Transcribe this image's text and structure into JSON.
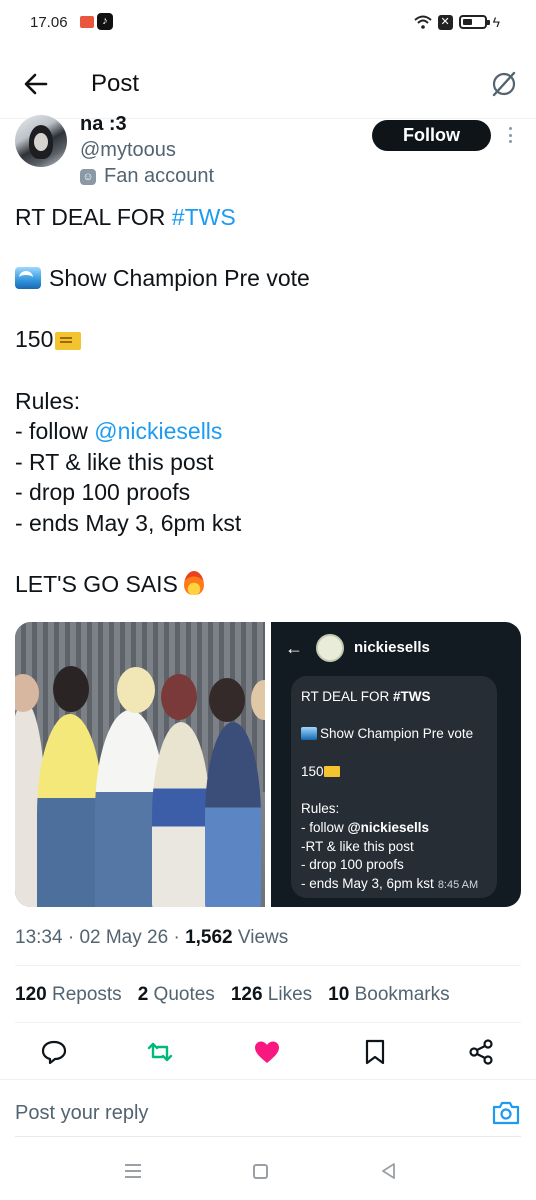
{
  "status_bar": {
    "time": "17.06",
    "battery_level": 0.45
  },
  "header": {
    "title": "Post",
    "back_icon": "arrow-left-icon",
    "grok_icon": "grok-icon"
  },
  "author": {
    "name": "na :3",
    "handle": "@mytoous",
    "label": "Fan account",
    "follow_label": "Follow"
  },
  "tweet": {
    "line1_prefix": "RT DEAL FOR ",
    "line1_tag": "#TWS",
    "line2": "Show Champion Pre vote",
    "line3": "150",
    "rules_title": "Rules:",
    "rule1_prefix": "- follow ",
    "rule1_mention": "@nickiesells",
    "rule2": "- RT & like this post",
    "rule3": "- drop 100 proofs",
    "rule4": "- ends May 3, 6pm kst",
    "closing": "LET'S GO SAIS"
  },
  "media_screenshot": {
    "account_name": "nickiesells",
    "line1_prefix": "RT DEAL FOR ",
    "line1_tag": "#TWS",
    "line2": "Show Champion Pre vote",
    "line3": "150",
    "rules_title": "Rules:",
    "rule1_prefix": "- follow ",
    "rule1_mention": "@nickiesells",
    "rule2": "-RT & like this post",
    "rule3": "- drop 100 proofs",
    "rule4": "- ends May 3, 6pm kst",
    "timestamp": "8:45 AM"
  },
  "meta": {
    "time": "13:34",
    "date": "02 May 26",
    "views_count": "1,562",
    "views_label": "Views"
  },
  "stats": {
    "reposts_count": "120",
    "reposts_label": "Reposts",
    "quotes_count": "2",
    "quotes_label": "Quotes",
    "likes_count": "126",
    "likes_label": "Likes",
    "bookmarks_count": "10",
    "bookmarks_label": "Bookmarks"
  },
  "reply": {
    "placeholder": "Post your reply"
  },
  "colors": {
    "link": "#1d9bf0",
    "like": "#f91880",
    "repost": "#00ba7c",
    "text": "#0f1419",
    "secondary": "#536471"
  }
}
